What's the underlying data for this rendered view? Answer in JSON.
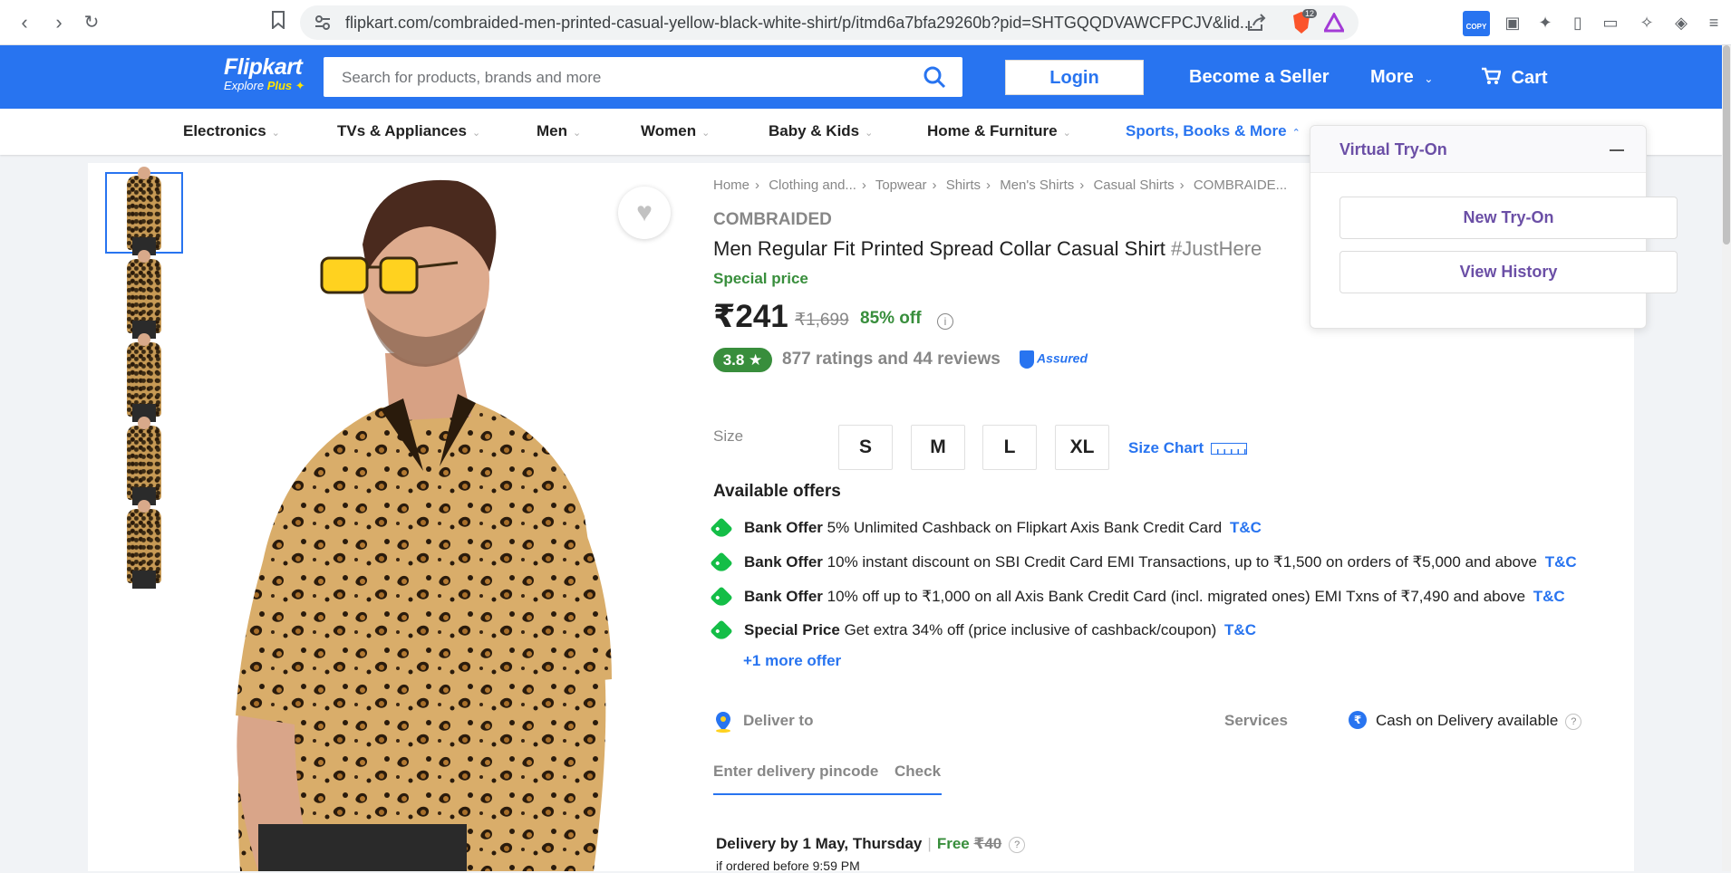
{
  "browser": {
    "url": "flipkart.com/combraided-men-printed-casual-yellow-black-white-shirt/p/itmd6a7bfa29260b?pid=SHTGQQDVAWCFPCJV&lid...",
    "ext_badge": "12",
    "copy_label": "COPY"
  },
  "header": {
    "logo": "Flipkart",
    "logo_sub_prefix": "Explore ",
    "logo_sub_plus": "Plus",
    "search_placeholder": "Search for products, brands and more",
    "login": "Login",
    "seller": "Become a Seller",
    "more": "More",
    "cart": "Cart"
  },
  "categories": [
    {
      "label": "Electronics"
    },
    {
      "label": "TVs & Appliances"
    },
    {
      "label": "Men"
    },
    {
      "label": "Women"
    },
    {
      "label": "Baby & Kids"
    },
    {
      "label": "Home & Furniture"
    },
    {
      "label": "Sports, Books & More"
    }
  ],
  "breadcrumbs": [
    "Home",
    "Clothing and...",
    "Topwear",
    "Shirts",
    "Men's Shirts",
    "Casual Shirts",
    "COMBRAIDE..."
  ],
  "product": {
    "brand": "COMBRAIDED",
    "title": "Men Regular Fit Printed Spread Collar Casual Shirt",
    "tag": "#JustHere",
    "special": "Special price",
    "price": "₹241",
    "mrp": "₹1,699",
    "off": "85% off",
    "rating": "3.8 ★",
    "reviews": "877 ratings and 44 reviews",
    "assured": "Assured"
  },
  "size": {
    "label": "Size",
    "options": [
      "S",
      "M",
      "L",
      "XL"
    ],
    "chart": "Size Chart"
  },
  "offers": {
    "heading": "Available offers",
    "items": [
      {
        "type": "Bank Offer",
        "text": "5% Unlimited Cashback on Flipkart Axis Bank Credit Card",
        "tc": "T&C"
      },
      {
        "type": "Bank Offer",
        "text": "10% instant discount on SBI Credit Card EMI Transactions, up to ₹1,500 on orders of ₹5,000 and above",
        "tc": "T&C"
      },
      {
        "type": "Bank Offer",
        "text": "10% off up to ₹1,000 on all Axis Bank Credit Card (incl. migrated ones) EMI Txns of ₹7,490 and above",
        "tc": "T&C"
      },
      {
        "type": "Special Price",
        "text": "Get extra 34% off (price inclusive of cashback/coupon)",
        "tc": "T&C"
      }
    ],
    "more": "+1 more offer"
  },
  "delivery": {
    "deliver_to": "Deliver to",
    "services": "Services",
    "cod": "Cash on Delivery available",
    "pincode_placeholder": "Enter delivery pincode",
    "check": "Check",
    "by": "Delivery by 1 May, Thursday",
    "free": "Free",
    "fee": "₹40",
    "cutoff": "if ordered before 9:59 PM"
  },
  "tryon": {
    "title": "Virtual Try-On",
    "new": "New Try-On",
    "history": "View History"
  }
}
